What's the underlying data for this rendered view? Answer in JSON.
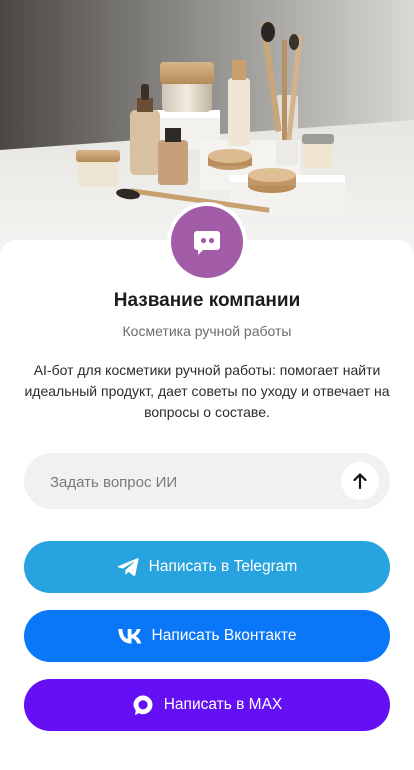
{
  "colors": {
    "avatar": "#a35ca8",
    "telegram": "#27a3df",
    "vk": "#0a77f8",
    "max": "#6510f4"
  },
  "hero": {
    "icon": "cosmetics-product-photo"
  },
  "profile": {
    "avatar_icon": "chat-bot-icon",
    "name": "Название компании",
    "subtitle": "Косметика ручной работы",
    "description": "AI-бот для косметики ручной работы: помогает найти идеальный продукт, дает советы по уходу и отвечает на вопросы о составе."
  },
  "ask": {
    "placeholder": "Задать вопрос ИИ",
    "value": "",
    "send_icon": "arrow-up-icon"
  },
  "buttons": {
    "telegram": {
      "label": "Написать в Telegram",
      "icon": "telegram-icon"
    },
    "vk": {
      "label": "Написать Вконтакте",
      "icon": "vk-icon"
    },
    "max": {
      "label": "Написать в MAX",
      "icon": "max-icon"
    }
  }
}
